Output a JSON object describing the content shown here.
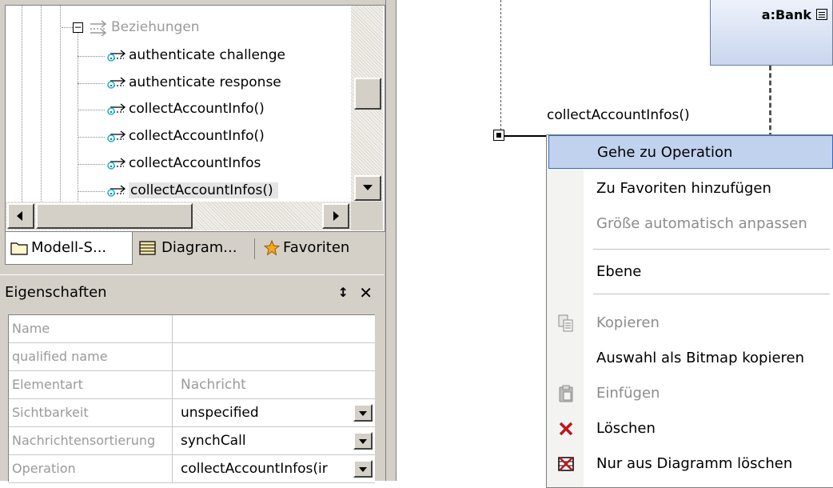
{
  "tree": {
    "group": "Beziehungen",
    "items": [
      "authenticate challenge",
      "authenticate response",
      "collectAccountInfo()",
      "collectAccountInfo()",
      "collectAccountInfos",
      "collectAccountInfos()"
    ]
  },
  "tabs": {
    "model": "Modell-S...",
    "diagram": "Diagram...",
    "favorites": "Favoriten"
  },
  "properties": {
    "title": "Eigenschaften",
    "pin_glyph": "↕",
    "close_glyph": "✕",
    "rows": [
      {
        "key": "Name",
        "value": ""
      },
      {
        "key": "qualified name",
        "value": ""
      },
      {
        "key": "Elementart",
        "value": "Nachricht"
      },
      {
        "key": "Sichtbarkeit",
        "value": "unspecified"
      },
      {
        "key": "Nachrichtensortierung",
        "value": "synchCall"
      },
      {
        "key": "Operation",
        "value": "collectAccountInfos(ir"
      }
    ]
  },
  "diagram": {
    "object_label": "a:Bank",
    "message_label": "collectAccountInfos()"
  },
  "menu": {
    "items": [
      {
        "label": "Gehe zu Operation"
      },
      {
        "label": "Zu Favoriten hinzufügen"
      },
      {
        "label": "Größe automatisch anpassen"
      },
      {
        "label": "Ebene"
      },
      {
        "label": "Kopieren"
      },
      {
        "label": "Auswahl als Bitmap kopieren"
      },
      {
        "label": "Einfügen"
      },
      {
        "label": "Löschen"
      },
      {
        "label": "Nur aus Diagramm löschen"
      }
    ]
  },
  "colors": {
    "menu_highlight": "#c1d2ee",
    "menu_highlight_border": "#316ac5",
    "panel_gray": "#d4d0c8",
    "delete_red": "#c0141d"
  }
}
